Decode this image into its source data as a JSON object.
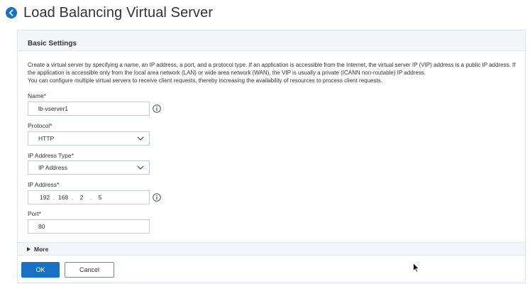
{
  "page": {
    "title": "Load Balancing Virtual Server",
    "back_icon": "back-arrow-circle-icon",
    "accent_color": "#1572c6"
  },
  "section": {
    "title": "Basic Settings",
    "description": [
      "Create a virtual server by specifying a name, an IP address, a port, and a protocol type. If an application is accessible from the Internet, the virtual server IP (VIP) address is a public IP address. If the application is accessible only from the local area network (LAN) or wide area network (WAN), the VIP is usually a private (ICANN non-routable) IP address.",
      "You can configure multiple virtual servers to receive client requests, thereby increasing the availability of resources to process client requests."
    ]
  },
  "form": {
    "name": {
      "label": "Name*",
      "value": "lb-vserver1"
    },
    "protocol": {
      "label": "Protocol*",
      "value": "HTTP"
    },
    "ip_address_type": {
      "label": "IP Address Type*",
      "value": "IP Address"
    },
    "ip_address": {
      "label": "IP Address*",
      "octets": [
        "192",
        "168",
        "2",
        "5"
      ],
      "separator": "."
    },
    "port": {
      "label": "Port*",
      "value": "80"
    }
  },
  "more": {
    "label": "More"
  },
  "actions": {
    "ok_label": "OK",
    "cancel_label": "Cancel"
  }
}
